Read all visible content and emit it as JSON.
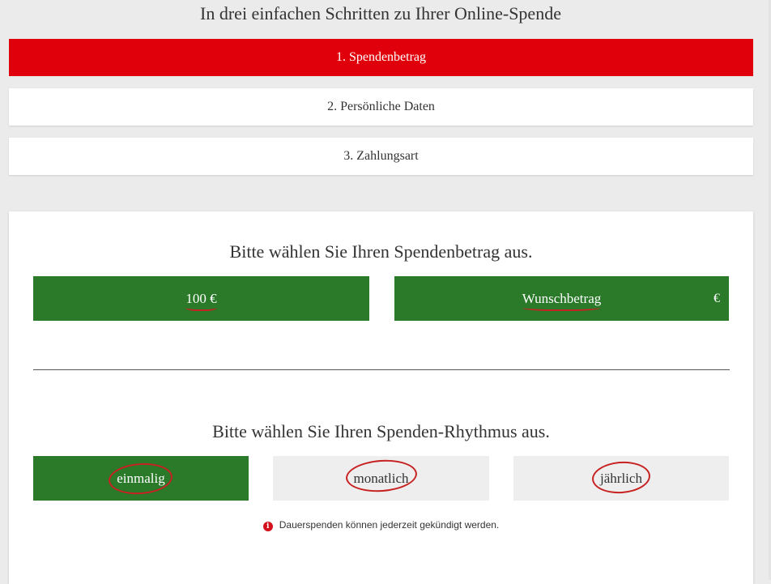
{
  "header": {
    "title": "In drei einfachen Schritten zu Ihrer Online-Spende"
  },
  "steps": [
    {
      "label": "1. Spendenbetrag",
      "active": true
    },
    {
      "label": "2. Persönliche Daten",
      "active": false
    },
    {
      "label": "3. Zahlungsart",
      "active": false
    }
  ],
  "amount_section": {
    "heading": "Bitte wählen Sie Ihren Spendenbetrag aus.",
    "preset_label": "100 €",
    "custom_placeholder": "Wunschbetrag",
    "currency_suffix": "€"
  },
  "rhythm_section": {
    "heading": "Bitte wählen Sie Ihren Spenden-Rhythmus aus.",
    "options": [
      {
        "label": "einmalig",
        "selected": true
      },
      {
        "label": "monatlich",
        "selected": false
      },
      {
        "label": "jährlich",
        "selected": false
      }
    ],
    "note": "Dauerspenden können jederzeit gekündigt werden."
  },
  "colors": {
    "accent_red": "#e0000b",
    "selected_green": "#2a7a2a",
    "annotation_red": "#c72121"
  },
  "icons": {
    "info": "info-circle-icon"
  }
}
